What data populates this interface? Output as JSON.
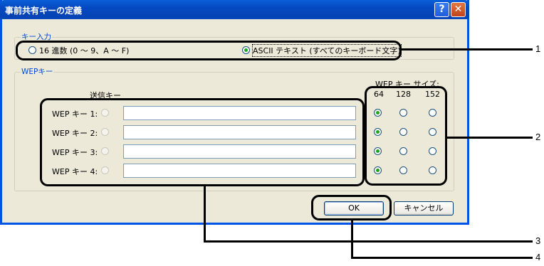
{
  "dialog": {
    "title": "事前共有キーの定義",
    "help_label": "?",
    "close_label": "✕"
  },
  "key_input": {
    "legend": "キー入力",
    "hex_option": "16 進数 (0 ～ 9、A ～ F)",
    "ascii_option": "ASCII テキスト (すべてのキーボード文字)",
    "selected": "ascii"
  },
  "wep": {
    "legend": "WEPキー",
    "send_key_label": "送信キー",
    "size_label": "WEP キー サイズ:",
    "sizes": [
      "64",
      "128",
      "152"
    ],
    "keys": [
      {
        "label": "WEP キー 1:",
        "value": "",
        "selected_size": "64"
      },
      {
        "label": "WEP キー 2:",
        "value": "",
        "selected_size": "64"
      },
      {
        "label": "WEP キー 3:",
        "value": "",
        "selected_size": "64"
      },
      {
        "label": "WEP キー 4:",
        "value": "",
        "selected_size": "64"
      }
    ]
  },
  "buttons": {
    "ok": "OK",
    "cancel": "キャンセル"
  },
  "callouts": [
    "1",
    "2",
    "3",
    "4"
  ]
}
